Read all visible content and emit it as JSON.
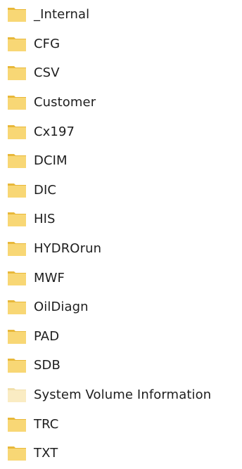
{
  "folders": [
    {
      "name": "_Internal",
      "icon": "folder-icon",
      "hidden": false
    },
    {
      "name": "CFG",
      "icon": "folder-icon",
      "hidden": false
    },
    {
      "name": "CSV",
      "icon": "folder-icon",
      "hidden": false
    },
    {
      "name": "Customer",
      "icon": "folder-icon",
      "hidden": false
    },
    {
      "name": "Cx197",
      "icon": "folder-icon",
      "hidden": false
    },
    {
      "name": "DCIM",
      "icon": "folder-icon",
      "hidden": false
    },
    {
      "name": "DIC",
      "icon": "folder-icon",
      "hidden": false
    },
    {
      "name": "HIS",
      "icon": "folder-icon",
      "hidden": false
    },
    {
      "name": "HYDROrun",
      "icon": "folder-icon",
      "hidden": false
    },
    {
      "name": "MWF",
      "icon": "folder-icon",
      "hidden": false
    },
    {
      "name": "OilDiagn",
      "icon": "folder-icon",
      "hidden": false
    },
    {
      "name": "PAD",
      "icon": "folder-icon",
      "hidden": false
    },
    {
      "name": "SDB",
      "icon": "folder-icon",
      "hidden": false
    },
    {
      "name": "System Volume Information",
      "icon": "folder-icon",
      "hidden": true
    },
    {
      "name": "TRC",
      "icon": "folder-icon",
      "hidden": false
    },
    {
      "name": "TXT",
      "icon": "folder-icon",
      "hidden": false
    }
  ],
  "colors": {
    "folder_front": "#f8d775",
    "folder_back": "#e8b83a",
    "folder_hidden_front": "#faecc3",
    "folder_hidden_back": "#f1dfab",
    "label_text": "#1e1e1e"
  }
}
